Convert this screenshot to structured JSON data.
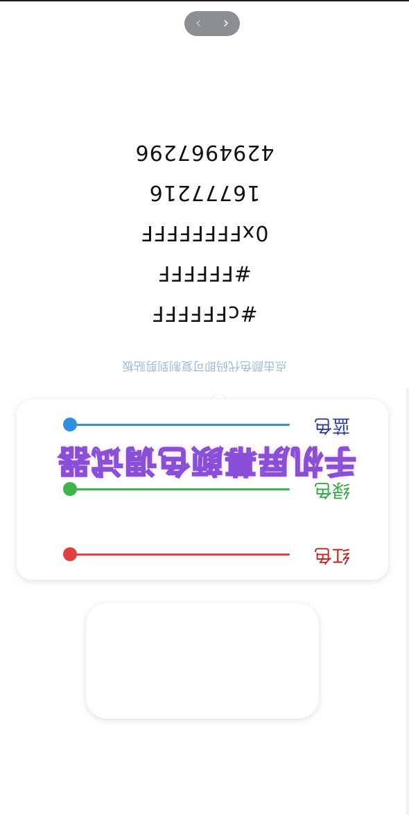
{
  "nav": {
    "prev_glyph": "‹",
    "next_glyph": "›",
    "prev_icon": "chevron-left-icon",
    "next_icon": "chevron-right-icon"
  },
  "color_codes": [
    "#cFFFFFF",
    "#FFFFFF",
    "0xFFFFFFFF",
    "16777216",
    "4294967296"
  ],
  "hint": "点击颜色代码即可复制到剪贴板",
  "sliders": [
    {
      "label": "蓝色",
      "color": "#2f8fe0",
      "label_color": "#2b3aa8",
      "value": 0
    },
    {
      "label": "绿色",
      "color": "#3cb44b",
      "label_color": "#2ea842",
      "value": 0
    },
    {
      "label": "红色",
      "color": "#e04040",
      "label_color": "#c81e1e",
      "value": 0
    }
  ],
  "watermark": "手机屏幕颜色调试器",
  "preview": {
    "color": "#ffffff"
  },
  "colors": {
    "nav_pill": "#8b8e93",
    "background": "#ffffff"
  }
}
